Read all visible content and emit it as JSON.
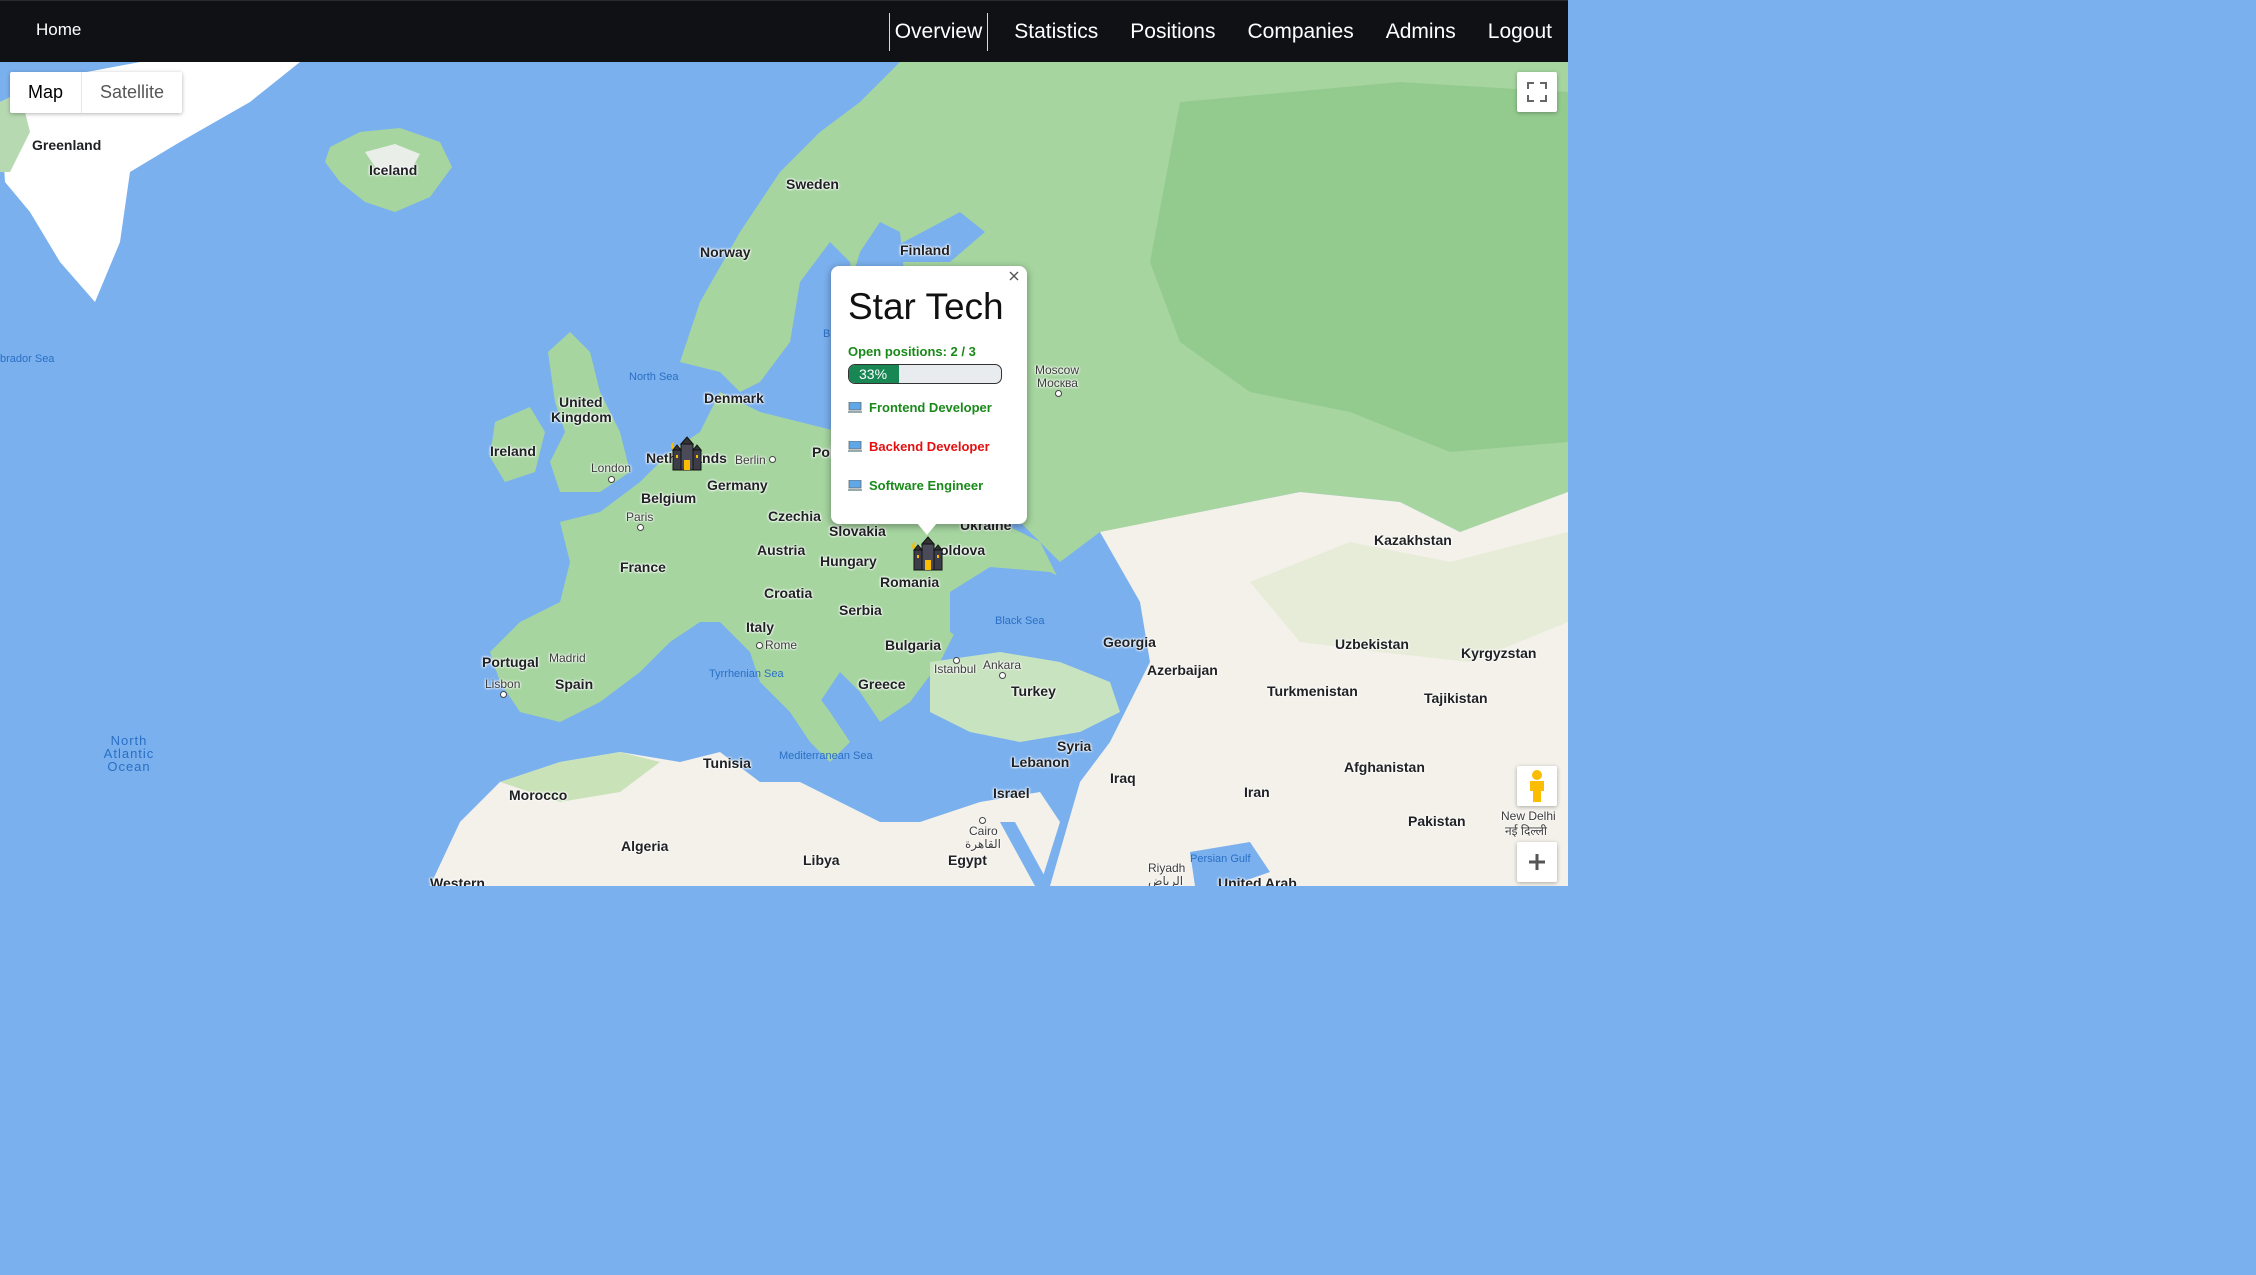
{
  "navbar": {
    "brand": "Home",
    "links": [
      "Overview",
      "Statistics",
      "Positions",
      "Companies",
      "Admins",
      "Logout"
    ],
    "active": "Overview"
  },
  "map_controls": {
    "map_label": "Map",
    "satellite_label": "Satellite",
    "selected": "Map",
    "fullscreen_icon": "fullscreen-icon",
    "pegman_icon": "street-view-pegman-icon",
    "zoom_in_icon": "plus-icon"
  },
  "map_labels": {
    "countries": [
      "Greenland",
      "Iceland",
      "Sweden",
      "Norway",
      "Finland",
      "United",
      "Kingdom",
      "Ireland",
      "Denmark",
      "Netherlands",
      "Belgium",
      "Germany",
      "Pol",
      "Czechia",
      "Slovakia",
      "France",
      "Austria",
      "Hungary",
      "Romania",
      "oldova",
      "Ukraine",
      "Croatia",
      "Serbia",
      "Italy",
      "Bulgaria",
      "Portugal",
      "Spain",
      "Greece",
      "Turkey",
      "Georgia",
      "Azerbaijan",
      "Kazakhstan",
      "Uzbekistan",
      "Kyrgyzstan",
      "Turkmenistan",
      "Tajikistan",
      "Afghanistan",
      "Pakistan",
      "Syria",
      "Lebanon",
      "Iraq",
      "Iran",
      "Israel",
      "Tunisia",
      "Morocco",
      "Algeria",
      "Libya",
      "Egypt",
      "Western",
      "United Arab"
    ],
    "cities": [
      "London",
      "Paris",
      "Berlin",
      "Moscow",
      "Москва",
      "Rome",
      "Madrid",
      "Lisbon",
      "Istanbul",
      "Ankara",
      "Cairo",
      "القاهرة",
      "Riyadh",
      "الرياض",
      "New Delhi",
      "नई दिल्ली"
    ],
    "seas": [
      "North Sea",
      "Black Sea",
      "Tyrrhenian Sea",
      "Mediterranean Sea",
      "Persian Gulf",
      "brador Sea",
      "B"
    ],
    "ocean": [
      "North",
      "Atlantic",
      "Ocean"
    ]
  },
  "markers": [
    {
      "name": "castle-marker-netherlands",
      "icon": "castle-icon"
    },
    {
      "name": "castle-marker-romania",
      "icon": "castle-icon"
    }
  ],
  "info_window": {
    "company": "Star Tech",
    "open_positions_text": "Open positions: 2 / 3",
    "progress_percent": 33,
    "progress_label": "33%",
    "positions": [
      {
        "title": "Frontend Developer",
        "status": "open",
        "color": "#198a19",
        "icon": "computer-icon"
      },
      {
        "title": "Backend Developer",
        "status": "closed",
        "color": "#e31010",
        "icon": "computer-icon"
      },
      {
        "title": "Software Engineer",
        "status": "open",
        "color": "#198a19",
        "icon": "computer-icon"
      }
    ],
    "close_icon": "close-icon"
  },
  "colors": {
    "navbar": "#0f1114",
    "water": "#7ab0ee",
    "land_green": "#a6d5a0",
    "land_desert": "#f3f1ea",
    "progress_fill": "#198754"
  }
}
